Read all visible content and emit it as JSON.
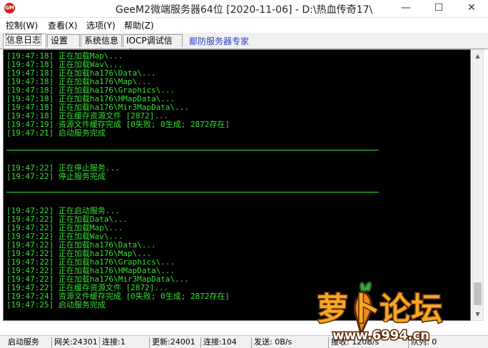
{
  "window": {
    "title": "GeeM2微端服务器64位 [2020-11-06] - D:\\热血传奇17\\",
    "minimize_glyph": "—",
    "maximize_glyph": "☐",
    "close_glyph": "✕",
    "icon_text": "GM"
  },
  "menu": [
    "控制(W)",
    "查看(X)",
    "选项(Y)",
    "帮助(Z)"
  ],
  "tabs": [
    "信息日志",
    "设置",
    "系统信息",
    "IOCP调试信息"
  ],
  "tab_link": "鄙防服务器专家",
  "log_lines": [
    "[19:47:18] 正在加载Map\\...",
    "[19:47:18] 正在加载Wav\\...",
    "[19:47:18] 正在加载ha176\\Data\\...",
    "[19:47:18] 正在加载ha176\\Map\\...",
    "[19:47:18] 正在加载ha176\\Graphics\\...",
    "[19:47:18] 正在加载ha176\\HMapData\\...",
    "[19:47:18] 正在加载ha176\\Mir3MapData\\...",
    "[19:47:18] 正在缓存资源文件 [2872]...",
    "[19:47:19] 资源文件缓存完成 [0失败; 0生成; 2872存在]",
    "[19:47:21] 启动服务完成",
    "[19:47:22] 正在停止服务...",
    "[19:47:22] 停止服务完成",
    "[19:47:22] 正在启动服务...",
    "[19:47:22] 正在加载Data\\...",
    "[19:47:22] 正在加载Map\\...",
    "[19:47:22] 正在加载Wav\\...",
    "[19:47:22] 正在加载ha176\\Data\\...",
    "[19:47:22] 正在加载ha176\\Map\\...",
    "[19:47:22] 正在加载ha176\\Graphics\\...",
    "[19:47:22] 正在加载ha176\\HMapData\\...",
    "[19:47:22] 正在加载ha176\\Mir3MapData\\...",
    "[19:47:22] 正在缓存资源文件 [2872]...",
    "[19:47:24] 资源文件缓存完成 [0失败; 0生成; 2872存在]",
    "[19:47:25] 启动服务完成"
  ],
  "status": {
    "state": "启动服务",
    "gateway_port": "网关:24301",
    "gateway_conn": "连接:1",
    "update_port": "更新:24001",
    "update_conn": "连接:104",
    "send": "发送: 0B/s",
    "recv": "接收: 120B/s",
    "queue": "队列: 0"
  },
  "watermark": {
    "logo_text": "萝卜论坛",
    "url": "www.6994.cn"
  },
  "colors": {
    "log_text": "#35e135",
    "log_bg": "#000000",
    "tab_link": "#2b3fc4",
    "watermark_fill": "#f5a623",
    "watermark_stroke": "#5a2a0a"
  }
}
